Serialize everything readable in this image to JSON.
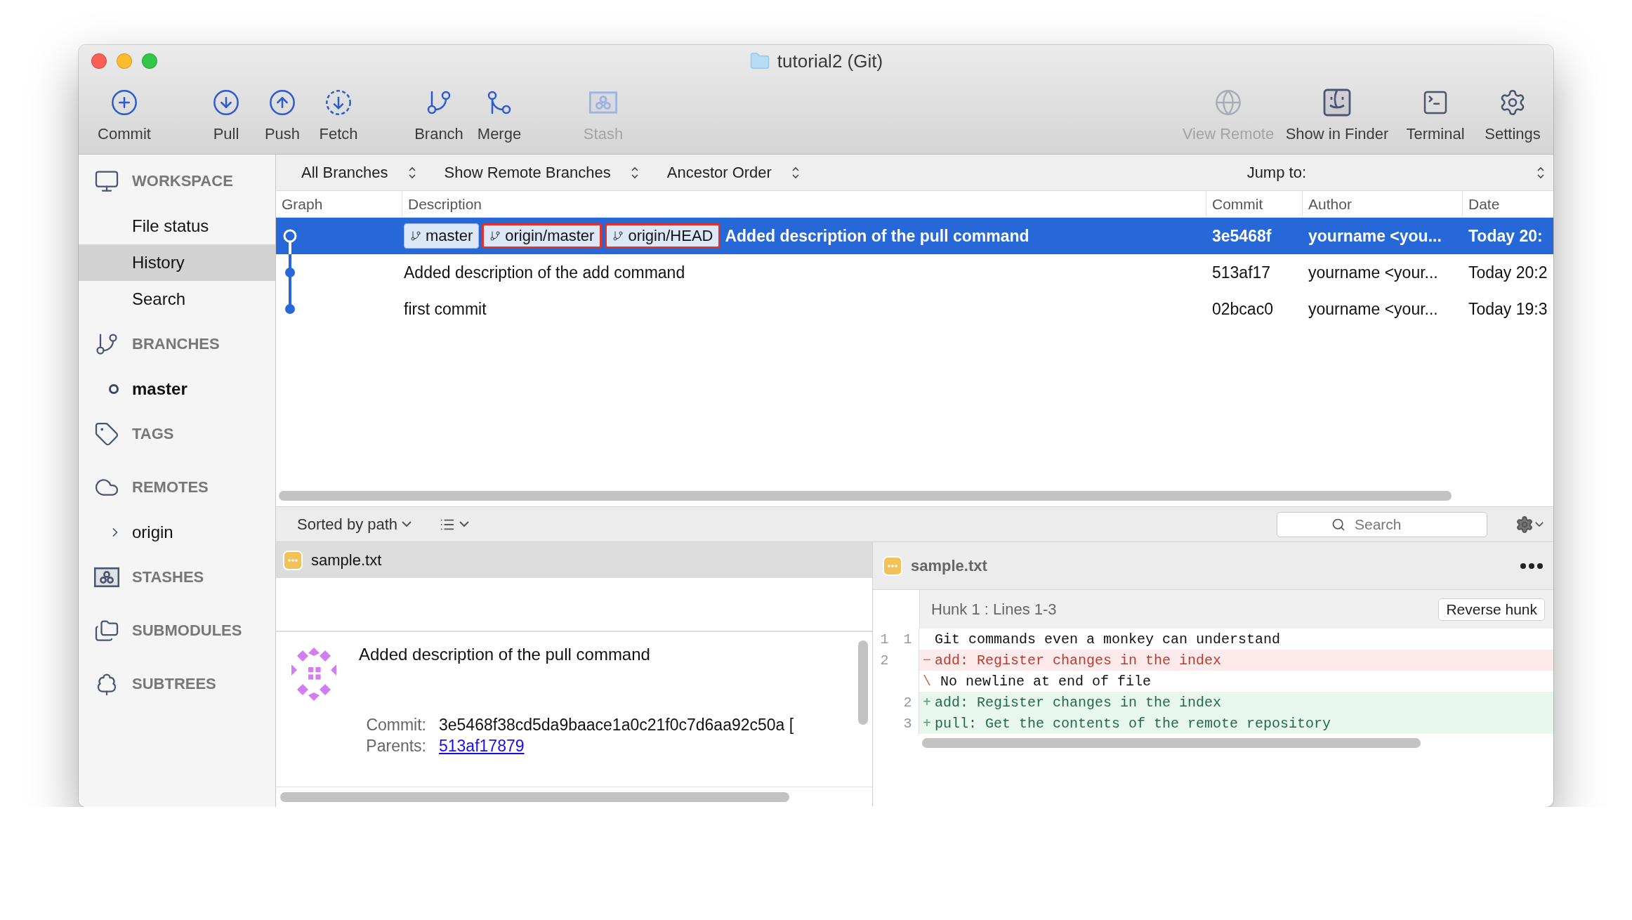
{
  "window": {
    "title": "tutorial2 (Git)"
  },
  "toolbar": {
    "left": [
      [
        {
          "label": "Commit",
          "disabled": false
        }
      ],
      [
        {
          "label": "Pull",
          "disabled": false
        },
        {
          "label": "Push",
          "disabled": false
        },
        {
          "label": "Fetch",
          "disabled": false
        }
      ],
      [
        {
          "label": "Branch",
          "disabled": false
        },
        {
          "label": "Merge",
          "disabled": false
        }
      ],
      [
        {
          "label": "Stash",
          "disabled": true
        }
      ]
    ],
    "right": [
      {
        "label": "View Remote",
        "disabled": true
      },
      {
        "label": "Show in Finder",
        "disabled": false
      },
      {
        "label": "Terminal",
        "disabled": false
      },
      {
        "label": "Settings",
        "disabled": false
      }
    ]
  },
  "sidebar": {
    "sections": [
      {
        "title": "WORKSPACE",
        "items": [
          {
            "label": "File status",
            "selected": false
          },
          {
            "label": "History",
            "selected": true
          },
          {
            "label": "Search",
            "selected": false
          }
        ]
      },
      {
        "title": "BRANCHES",
        "items": [
          {
            "label": "master",
            "selected": false,
            "current": true
          }
        ]
      },
      {
        "title": "TAGS"
      },
      {
        "title": "REMOTES",
        "items": [
          {
            "label": "origin",
            "selected": false,
            "expanded": false
          }
        ]
      },
      {
        "title": "STASHES"
      },
      {
        "title": "SUBMODULES"
      },
      {
        "title": "SUBTREES"
      }
    ]
  },
  "filters": {
    "selects": [
      "All Branches",
      "Show Remote Branches",
      "Ancestor Order"
    ],
    "jump_label": "Jump to:"
  },
  "history": {
    "columns": [
      "Graph",
      "Description",
      "Commit",
      "Author",
      "Date"
    ],
    "rows": [
      {
        "selected": true,
        "refs": [
          {
            "label": "master",
            "highlighted": false
          },
          {
            "label": "origin/master",
            "highlighted": true
          },
          {
            "label": "origin/HEAD",
            "highlighted": true
          }
        ],
        "description": "Added description of the pull command",
        "commit": "3e5468f",
        "author": "yourname <you...",
        "date": "Today 20:"
      },
      {
        "selected": false,
        "description": "Added description of the add command",
        "commit": "513af17",
        "author": "yourname <your...",
        "date": "Today 20:2"
      },
      {
        "selected": false,
        "description": "first commit",
        "commit": "02bcac0",
        "author": "yourname <your...",
        "date": "Today 19:3"
      }
    ]
  },
  "files_toolbar": {
    "sort": "Sorted by path",
    "search_placeholder": "Search"
  },
  "files": [
    {
      "name": "sample.txt",
      "selected": true
    }
  ],
  "details": {
    "message": "Added description of the pull command",
    "fields": [
      {
        "label": "Commit:",
        "value": "3e5468f38cd5da9baace1a0c21f0c7d6aa92c50a ["
      },
      {
        "label": "Parents:",
        "value": "513af17879",
        "link": true
      }
    ]
  },
  "diff": {
    "file": "sample.txt",
    "hunk": "Hunk 1 : Lines 1-3",
    "hunk_button": "Reverse hunk",
    "lines": [
      {
        "kind": "context",
        "old": "1",
        "new": "1",
        "text": "Git commands even a monkey can understand"
      },
      {
        "kind": "removed",
        "old": "2",
        "sign": "−",
        "text": "add: Register changes in the index"
      },
      {
        "kind": "note",
        "sign": "\\",
        "text": "No newline at end of file"
      },
      {
        "kind": "added",
        "new": "2",
        "sign": "+",
        "text": "add: Register changes in the index"
      },
      {
        "kind": "added",
        "new": "3",
        "sign": "+",
        "text": "pull: Get the contents of the remote repository"
      }
    ]
  }
}
